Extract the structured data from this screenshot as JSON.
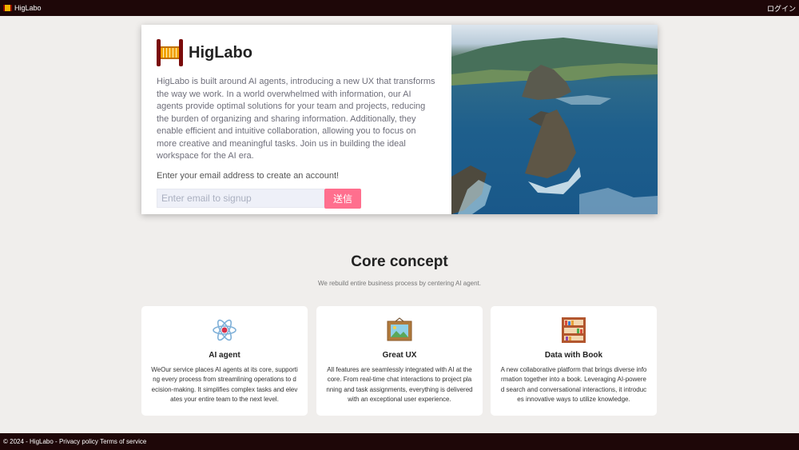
{
  "topbar": {
    "brand": "HigLabo",
    "login": "ログイン"
  },
  "hero": {
    "title": "HigLabo",
    "description": "HigLabo is built around AI agents, introducing a new UX that transforms the way we work. In a world overwhelmed with information, our AI agents provide optimal solutions for your team and projects, reducing the burden of organizing and sharing information. Additionally, they enable efficient and intuitive collaboration, allowing you to focus on more creative and meaningful tasks. Join us in building the ideal workspace for the AI era.",
    "cta": "Enter your email address to create an account!",
    "email_placeholder": "Enter email to signup",
    "email_value": "",
    "submit_label": "送信"
  },
  "concept": {
    "title": "Core concept",
    "subtitle": "We rebuild entire business process by centering AI agent."
  },
  "cards": [
    {
      "icon": "atom-icon",
      "title": "AI agent",
      "body": "WeOur service places AI agents at its core, supporting every process from streamlining operations to decision-making. It simplifies complex tasks and elevates your entire team to the next level."
    },
    {
      "icon": "framed-picture-icon",
      "title": "Great UX",
      "body": "All features are seamlessly integrated with AI at the core. From real-time chat interactions to project planning and task assignments, everything is delivered with an exceptional user experience."
    },
    {
      "icon": "bookshelf-icon",
      "title": "Data with Book",
      "body": "A new collaborative platform that brings diverse information together into a book. Leveraging AI-powered search and conversational interactions, it introduces innovative ways to utilize knowledge."
    }
  ],
  "footer": {
    "copyright": "© 2024 - HigLabo -",
    "privacy": "Privacy policy",
    "terms": "Terms of service"
  }
}
